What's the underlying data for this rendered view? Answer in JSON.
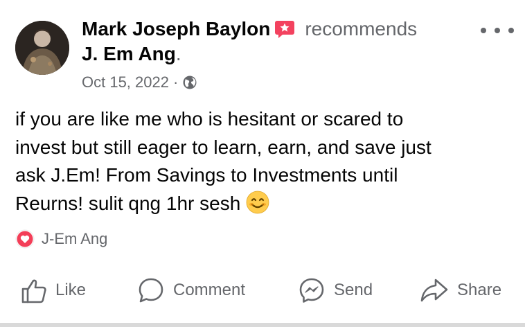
{
  "post": {
    "author": "Mark Joseph Baylon",
    "recommends_text": "recommends",
    "recommended_page": "J. Em Ang",
    "period": ".",
    "date": "Oct 15, 2022",
    "meta_separator": "·",
    "audience_icon": "globe-icon",
    "text_lines": [
      "if you are like me who is hesitant or scared to",
      "invest but still eager to learn, earn, and save just",
      "ask J.Em! From Savings to Investments until",
      "Reurns! sulit qng 1hr sesh"
    ],
    "emoji": "smiling-face-icon"
  },
  "reactions": {
    "icon": "love-icon",
    "name": "J-Em Ang"
  },
  "actions": [
    {
      "label": "Like",
      "icon": "thumbs-up-icon"
    },
    {
      "label": "Comment",
      "icon": "comment-icon"
    },
    {
      "label": "Send",
      "icon": "messenger-icon"
    },
    {
      "label": "Share",
      "icon": "share-arrow-icon"
    }
  ],
  "colors": {
    "text_primary": "#050505",
    "text_secondary": "#65676b",
    "recommend_badge": "#f3425f",
    "love_red": "#f33e58",
    "separator": "#d9d9d9"
  }
}
